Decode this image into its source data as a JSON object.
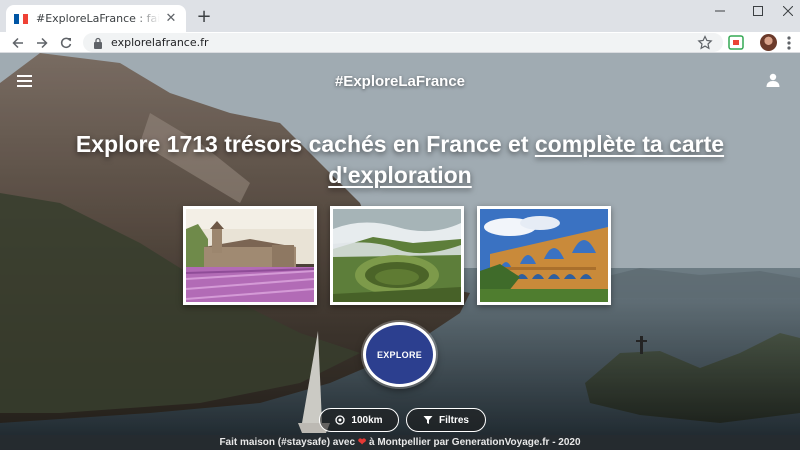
{
  "browser": {
    "tab_title": "#ExploreLaFrance : faire vivre le t",
    "tab_close": "✕",
    "new_tab": "+",
    "url": "explorelafrance.fr",
    "window_controls": {
      "minimize": "—",
      "maximize": "☐",
      "close": "✕"
    }
  },
  "header": {
    "brand": "#ExploreLaFrance",
    "menu_icon": "hamburger-icon",
    "user_icon": "user-icon"
  },
  "hero": {
    "headline_start": "Explore 1713 trésors cachés en France et ",
    "headline_link": "complète ta carte d'exploration"
  },
  "photos": [
    {
      "name": "abbey-lavender-photo"
    },
    {
      "name": "volcano-crater-photo"
    },
    {
      "name": "roman-aqueduct-photo"
    }
  ],
  "actions": {
    "explore_label": "EXPLORE",
    "distance_label": "100km",
    "filters_label": "Filtres"
  },
  "footer": {
    "before_heart": "Fait maison (#staysafe) avec ",
    "after_heart": " à Montpellier par GenerationVoyage.fr - 2020"
  },
  "colors": {
    "explore_button": "#2c3f8f",
    "heart": "#e53935",
    "footer_bg": "#262b30"
  }
}
